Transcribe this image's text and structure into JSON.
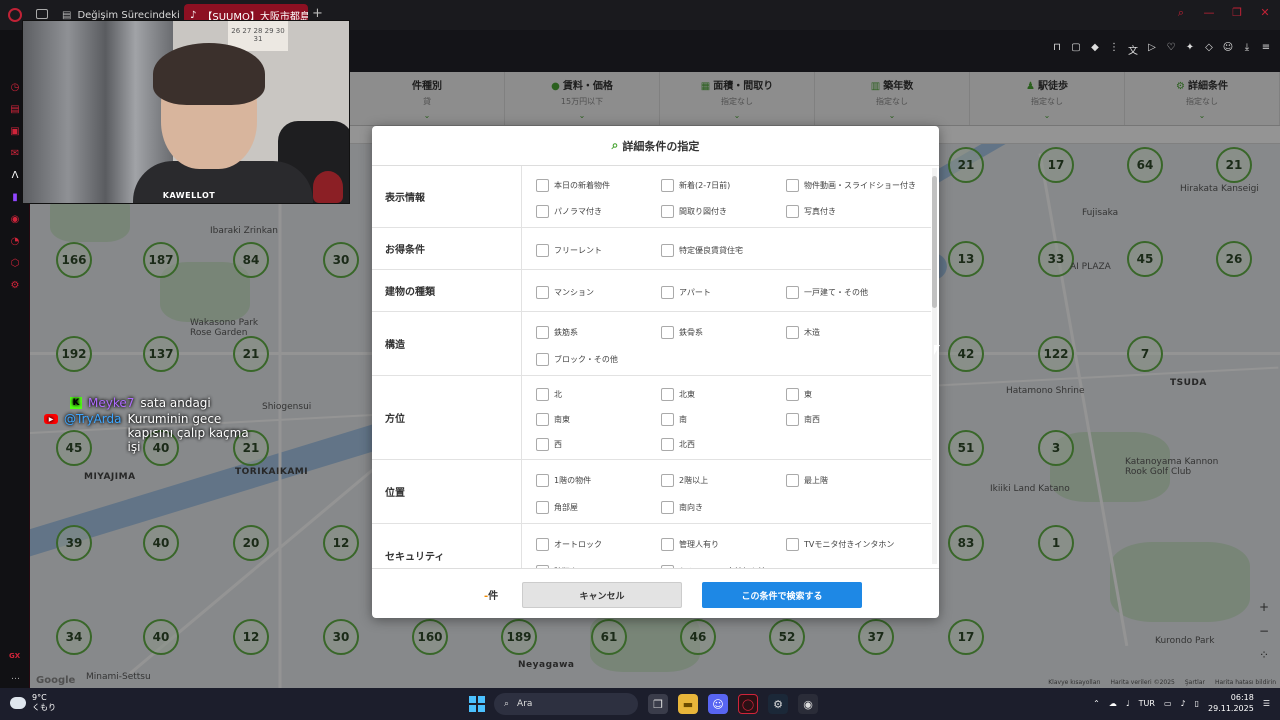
{
  "browser": {
    "tabs": [
      {
        "title": "Değişim Sürecindeki Cat",
        "active": false
      },
      {
        "title": "【SUUMO】大阪市都島区の",
        "active": true
      }
    ],
    "new_tab": "+"
  },
  "condition_bar": {
    "columns": [
      {
        "title": "件種別",
        "sub": "貸"
      },
      {
        "title": "賃料・価格",
        "sub": "15万円以下"
      },
      {
        "title": "面積・間取り",
        "sub": "指定なし"
      },
      {
        "title": "築年数",
        "sub": "指定なし"
      },
      {
        "title": "駅徒歩",
        "sub": "指定なし"
      },
      {
        "title": "詳細条件",
        "sub": "指定なし"
      }
    ]
  },
  "webcam": {
    "name": "KAWELLOT",
    "calendar": "26 27 28 29 30 31"
  },
  "chat": [
    {
      "user": "Meyke7",
      "message": "sata andagi"
    },
    {
      "user": "@TryArda",
      "message": "Kuruminin gece kapısını çalıp kaçma işi"
    }
  ],
  "modal": {
    "title": "詳細条件の指定",
    "sections": [
      {
        "label": "表示情報",
        "options": [
          "本日の新着物件",
          "新着(2-7日前)",
          "物件動画・スライドショー付き",
          "パノラマ付き",
          "間取り図付き",
          "写真付き"
        ]
      },
      {
        "label": "お得条件",
        "options": [
          "フリーレント",
          "特定優良賃貸住宅"
        ]
      },
      {
        "label": "建物の種類",
        "options": [
          "マンション",
          "アパート",
          "一戸建て・その他"
        ]
      },
      {
        "label": "構造",
        "options": [
          "鉄筋系",
          "鉄骨系",
          "木造",
          "ブロック・その他"
        ]
      },
      {
        "label": "方位",
        "options": [
          "北",
          "北東",
          "東",
          "南東",
          "南",
          "南西",
          "西",
          "北西"
        ]
      },
      {
        "label": "位置",
        "options": [
          "1階の物件",
          "2階以上",
          "最上階",
          "角部屋",
          "南向き"
        ]
      },
      {
        "label": "セキュリティ",
        "options": [
          "オートロック",
          "管理人有り",
          "TVモニタ付きインタホン",
          "防犯カメラ",
          "セキュリティ会社加入済"
        ]
      }
    ],
    "count_prefix": "-",
    "count_suffix": "件",
    "cancel_label": "キャンセル",
    "search_label": "この条件で検索する"
  },
  "map": {
    "markers": [
      {
        "n": "166"
      },
      {
        "n": "187"
      },
      {
        "n": "84"
      },
      {
        "n": "30"
      },
      {
        "n": "192"
      },
      {
        "n": "137"
      },
      {
        "n": "21"
      },
      {
        "n": "45"
      },
      {
        "n": "40"
      },
      {
        "n": "21"
      },
      {
        "n": "39"
      },
      {
        "n": "40"
      },
      {
        "n": "20"
      },
      {
        "n": "12"
      },
      {
        "n": "34"
      },
      {
        "n": "40"
      },
      {
        "n": "12"
      },
      {
        "n": "30"
      },
      {
        "n": "160"
      },
      {
        "n": "189"
      },
      {
        "n": "61"
      },
      {
        "n": "46"
      },
      {
        "n": "52"
      },
      {
        "n": "37"
      },
      {
        "n": "17"
      },
      {
        "n": "21"
      },
      {
        "n": "17"
      },
      {
        "n": "64"
      },
      {
        "n": "21"
      },
      {
        "n": "13"
      },
      {
        "n": "33"
      },
      {
        "n": "45"
      },
      {
        "n": "26"
      },
      {
        "n": "42"
      },
      {
        "n": "122"
      },
      {
        "n": "7"
      },
      {
        "n": "51"
      },
      {
        "n": "3"
      },
      {
        "n": "83"
      },
      {
        "n": "1"
      }
    ],
    "places": [
      "Ibaraki Zrinkan",
      "Wakasono Park Rose Garden",
      "MIYAJIMA",
      "TORIKAIKAMI",
      "Shiogensui",
      "Fujisaka",
      "AI PLAZA",
      "TSUDA",
      "Hatamono Shrine",
      "Katanoyama Kannon Rook Golf Club",
      "Neyagawa",
      "Minami-Settsu",
      "Hirakata Kanseigi",
      "Kurondo Park",
      "Ikiiki Land Katano"
    ],
    "footer": [
      "Klavye kısayolları",
      "Harita verileri ©2025",
      "Şartlar",
      "Harita hatası bildirin"
    ],
    "google": "Google"
  },
  "taskbar": {
    "temp": "9°C",
    "weather_desc": "くもり",
    "search": "Ara",
    "lang": "TUR",
    "time": "06:18",
    "date": "29.11.2025"
  }
}
